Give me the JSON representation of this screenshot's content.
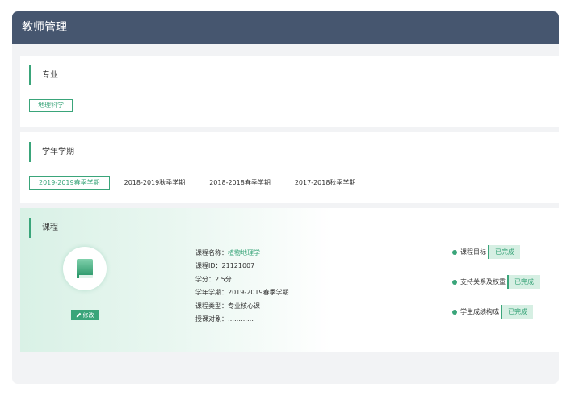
{
  "window": {
    "title": "教师管理"
  },
  "major": {
    "section_title": "专业",
    "tag": "地理科学"
  },
  "term": {
    "section_title": "学年学期",
    "items": [
      {
        "label": "2019-2019春季学期",
        "active": true
      },
      {
        "label": "2018-2019秋季学期",
        "active": false
      },
      {
        "label": "2018-2018春季学期",
        "active": false
      },
      {
        "label": "2017-2018秋季学期",
        "active": false
      }
    ]
  },
  "course": {
    "section_title": "课程",
    "edit_label": "修改",
    "name_label": "课程名称：",
    "name_value": "植物地理学",
    "id_line": "课程ID：21121007",
    "credit_line": "学分：2.5分",
    "term_line": "学年学期：2019-2019春季学期",
    "type_line": "课程类型：专业核心课",
    "audience_line": "授课对象：…………",
    "statuses": [
      {
        "label": "课程目标",
        "badge": "已完成"
      },
      {
        "label": "支持关系及权重",
        "badge": "已完成"
      },
      {
        "label": "学生成绩构成",
        "badge": "已完成"
      }
    ]
  },
  "colors": {
    "accent": "#3aa57a",
    "header": "#46566f",
    "icons": [
      "book-icon",
      "pencil-icon"
    ]
  }
}
